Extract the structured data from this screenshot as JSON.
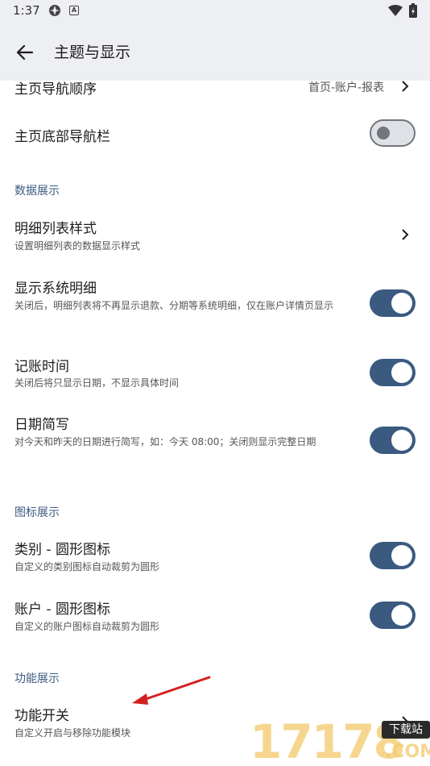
{
  "status_bar": {
    "time": "1:37",
    "app_icon_2": "A"
  },
  "app_bar": {
    "title": "主题与显示"
  },
  "rows": {
    "nav_order": {
      "title": "主页导航顺序",
      "value": "首页-账户-报表"
    },
    "bottom_nav": {
      "title": "主页底部导航栏",
      "toggle": "off"
    },
    "detail_style": {
      "title": "明细列表样式",
      "subtitle": "设置明细列表的数据显示样式"
    },
    "system_detail": {
      "title": "显示系统明细",
      "subtitle": "关闭后，明细列表将不再显示退款、分期等系统明细，仅在账户详情页显示",
      "toggle": "on"
    },
    "record_time": {
      "title": "记账时间",
      "subtitle": "关闭后将只显示日期，不显示具体时间",
      "toggle": "on"
    },
    "date_short": {
      "title": "日期简写",
      "subtitle": "对今天和昨天的日期进行简写，如：今天 08:00；关闭则显示完整日期",
      "toggle": "on"
    },
    "category_icon": {
      "title": "类别 - 圆形图标",
      "subtitle": "自定义的类别图标自动裁剪为圆形",
      "toggle": "on"
    },
    "account_icon": {
      "title": "账户 - 圆形图标",
      "subtitle": "自定义的账户图标自动裁剪为圆形",
      "toggle": "on"
    },
    "feature_switch": {
      "title": "功能开关",
      "subtitle": "自定义开启与移除功能模块"
    }
  },
  "sections": {
    "data_display": "数据展示",
    "icon_display": "图标展示",
    "feature_display": "功能展示"
  },
  "watermark": {
    "digits": "17178",
    "tag": "下载站",
    "suffix": ".COM"
  },
  "colors": {
    "accent": "#3a5a80",
    "section": "#3d5a80",
    "appbar": "#eeeff3",
    "annotation_arrow": "#d42020"
  }
}
